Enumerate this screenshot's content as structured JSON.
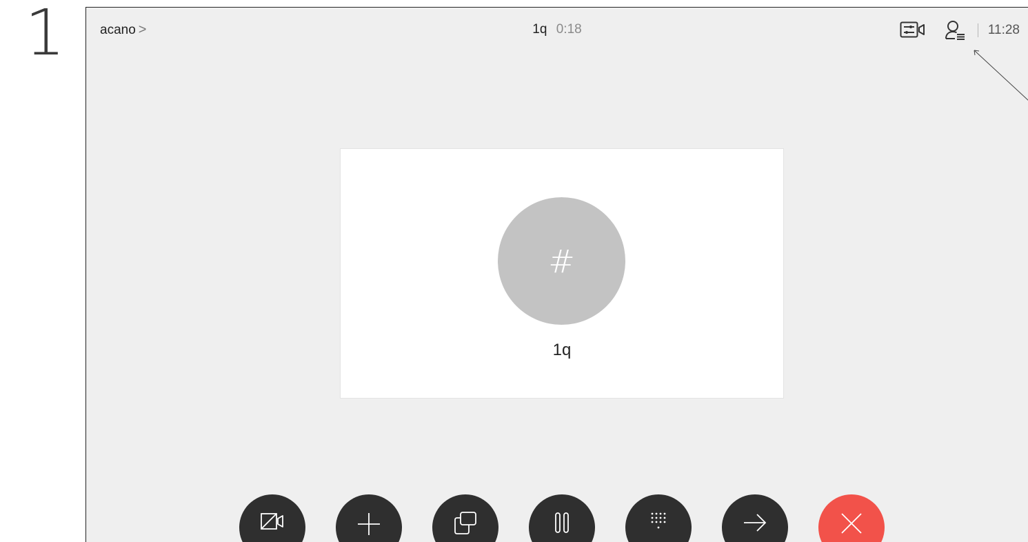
{
  "step": {
    "number": "1"
  },
  "header": {
    "breadcrumb_label": "acano",
    "breadcrumb_chevron": ">",
    "call_name": "1q",
    "call_timer": "0:18",
    "clock": "11:28",
    "icons": [
      "layout-control-icon",
      "participants-icon"
    ]
  },
  "participant": {
    "avatar_glyph": "#",
    "name": "1q",
    "avatar_color": "#c3c3c3"
  },
  "controls": [
    {
      "id": "camera-off",
      "icon": "camera-off-icon"
    },
    {
      "id": "add",
      "icon": "plus-icon"
    },
    {
      "id": "share",
      "icon": "share-screen-icon"
    },
    {
      "id": "hold",
      "icon": "pause-icon"
    },
    {
      "id": "keypad",
      "icon": "keypad-icon"
    },
    {
      "id": "transfer",
      "icon": "arrow-right-icon"
    },
    {
      "id": "end",
      "icon": "close-icon"
    }
  ],
  "colors": {
    "background": "#efefef",
    "control_button": "#2f2f2f",
    "end_call": "#f2524a"
  }
}
